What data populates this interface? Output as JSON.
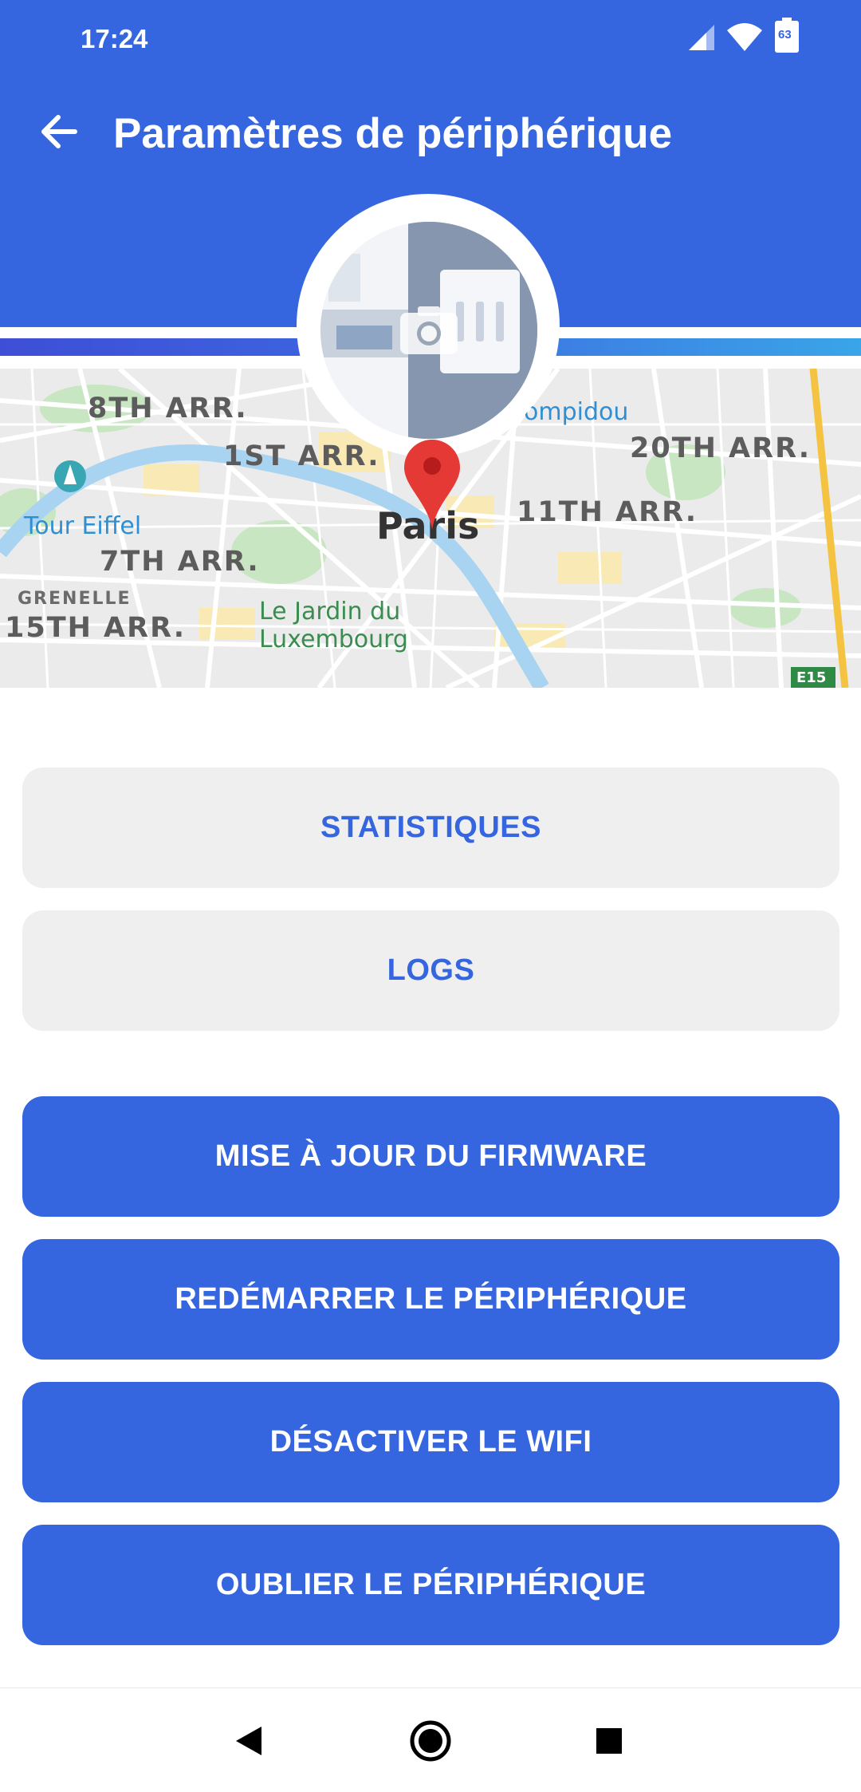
{
  "status_bar": {
    "time": "17:24",
    "battery_level": "63"
  },
  "app_bar": {
    "title": "Paramètres de périphérique",
    "back_icon": "arrow-left-icon"
  },
  "device_photo": {
    "overlay_icon": "camera-icon"
  },
  "map": {
    "labels": {
      "arr8": "8TH ARR.",
      "arr1": "1ST ARR.",
      "pompidou": "e Pompidou",
      "arr20": "20TH ARR.",
      "tour_eiffel": "Tour Eiffel",
      "paris": "Paris",
      "arr11": "11TH ARR.",
      "arr7": "7TH ARR.",
      "grenelle": "GRENELLE",
      "arr15": "15TH ARR.",
      "jardin_line1": "Le Jardin du",
      "jardin_line2": "Luxembourg",
      "route": "E15"
    },
    "marker_icon": "map-pin-icon"
  },
  "actions": {
    "statistics": "STATISTIQUES",
    "logs": "LOGS",
    "firmware": "MISE À JOUR DU FIRMWARE",
    "restart": "REDÉMARRER LE PÉRIPHÉRIQUE",
    "disable_wifi": "DÉSACTIVER LE WIFI",
    "forget": "OUBLIER LE PÉRIPHÉRIQUE"
  },
  "colors": {
    "primary": "#3566e0",
    "light_button": "#efefef",
    "pin": "#e53935"
  },
  "nav_bar": {
    "back": "back-triangle-icon",
    "home": "home-circle-icon",
    "recents": "recents-square-icon"
  }
}
